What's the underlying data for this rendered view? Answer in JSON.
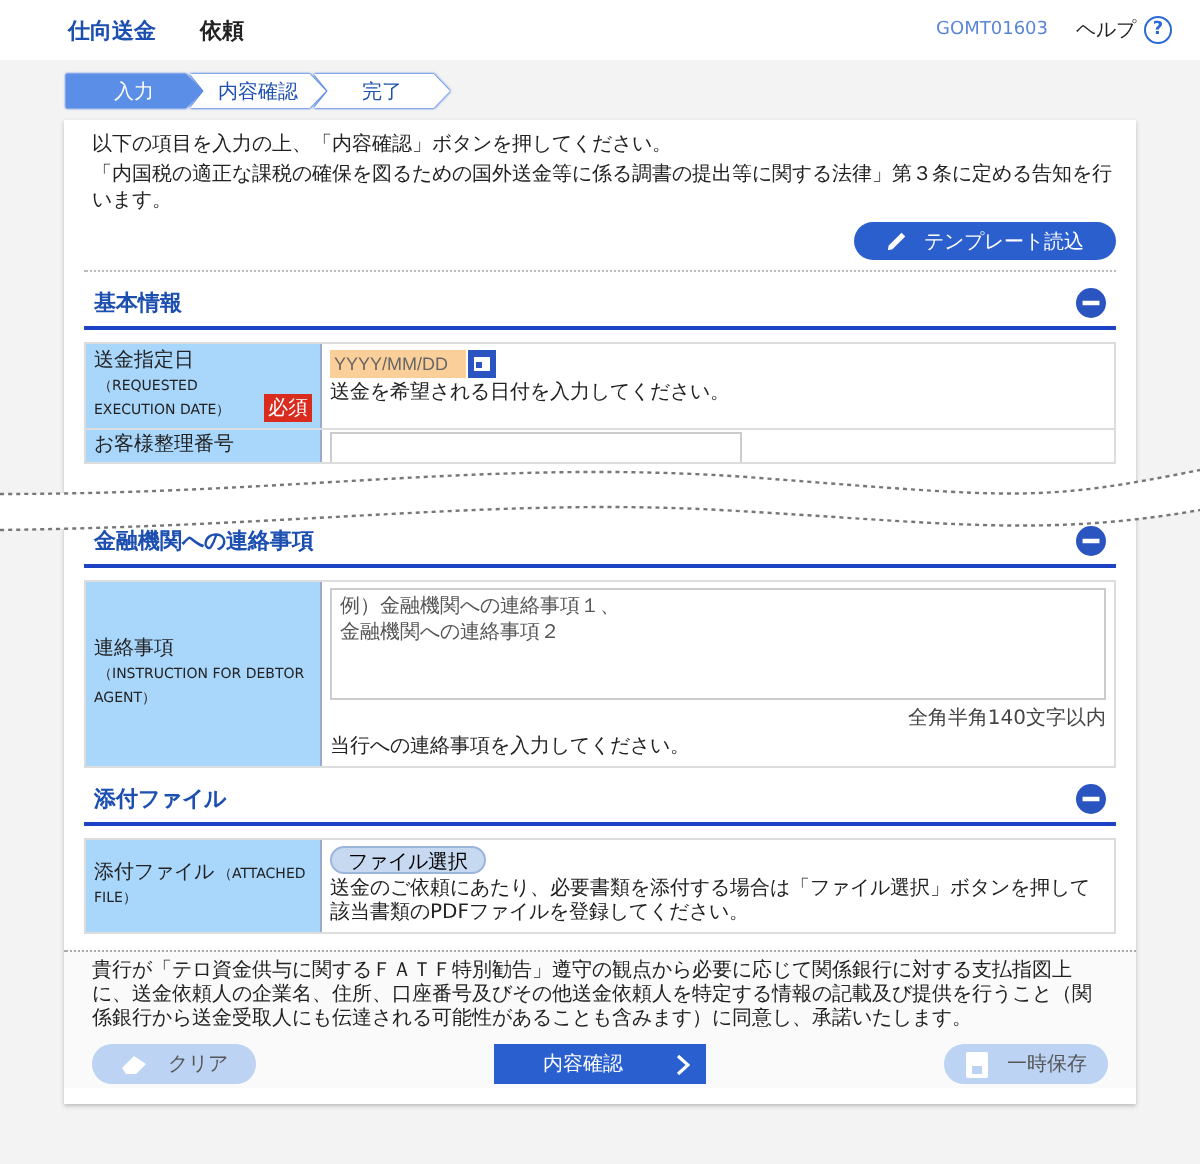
{
  "header": {
    "title": "仕向送金",
    "subtitle": "依頼",
    "screen_id": "GOMT01603",
    "help": "ヘルプ",
    "help_icon": "?"
  },
  "steps": [
    {
      "label": "入力",
      "selected": true
    },
    {
      "label": "内容確認",
      "selected": false
    },
    {
      "label": "完了",
      "selected": false
    }
  ],
  "intro": [
    "以下の項目を入力の上、「内容確認」ボタンを押してください。",
    "「内国税の適正な課税の確保を図るための国外送金等に係る調書の提出等に関する法律」第３条に定める告知を行います。"
  ],
  "template_button": "テンプレート読込",
  "sections": [
    {
      "title": "基本情報",
      "expanded": true,
      "rows": [
        {
          "kind": "date",
          "label": "送金指定日",
          "label_en": "（REQUESTED EXECUTION DATE）",
          "required": "必須",
          "placeholder": "YYYY/MM/DD",
          "hint": "送金を希望される日付を入力してください。"
        },
        {
          "kind": "cut",
          "label": "お客様整理番号"
        }
      ]
    },
    {
      "title": "金融機関への連絡事項",
      "expanded": true,
      "rows": [
        {
          "kind": "textarea",
          "label": "連絡事項",
          "label_en": "（INSTRUCTION FOR DEBTOR AGENT）",
          "placeholder": "例）金融機関への連絡事項１、金融機関への連絡事項２",
          "limit": "全角半角140文字以内",
          "hint": "当行への連絡事項を入力してください。"
        }
      ]
    },
    {
      "title": "添付ファイル",
      "expanded": true,
      "rows": [
        {
          "kind": "file",
          "label": "添付ファイル",
          "label_en": "（ATTACHED FILE）",
          "button": "ファイル選択",
          "hint": "送金のご依頼にあたり、必要書類を添付する場合は「ファイル選択」ボタンを押して該当書類のPDFファイルを登録してください。"
        }
      ]
    }
  ],
  "consent": "貴行が「テロ資金供与に関するＦＡＴＦ特別勧告」遵守の観点から必要に応じて関係銀行に対する支払指図上に、送金依頼人の企業名、住所、口座番号及びその他送金依頼人を特定する情報の記載及び提供を行うこと（関係銀行から送金受取人にも伝達される可能性があることも含みます）に同意し、承諾いたします。",
  "buttons": [
    {
      "kind": "clear",
      "label": "クリア",
      "disabled": true
    },
    {
      "kind": "confirm",
      "label": "内容確認",
      "disabled": false
    },
    {
      "kind": "save",
      "label": "一時保存",
      "disabled": true
    }
  ]
}
